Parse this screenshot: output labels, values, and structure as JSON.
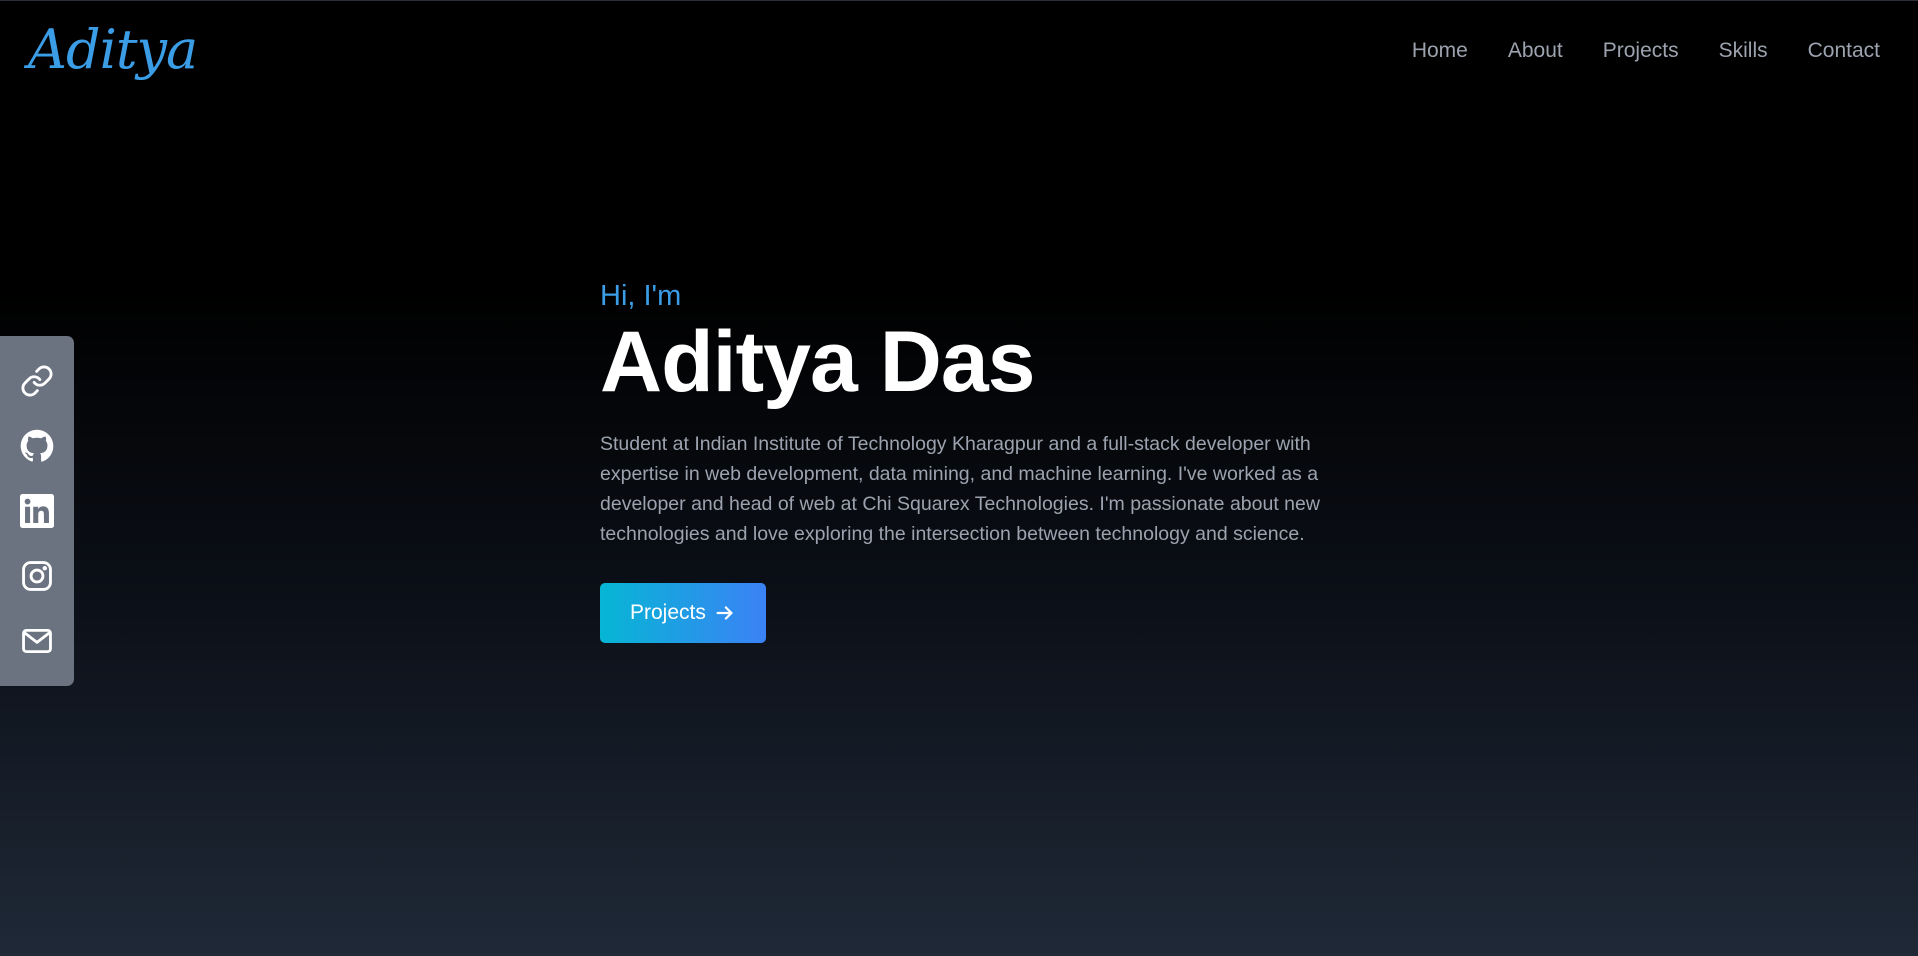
{
  "brand": {
    "logo_text": "Aditya",
    "accent_color": "#3b9de6"
  },
  "nav": {
    "items": [
      {
        "label": "Home"
      },
      {
        "label": "About"
      },
      {
        "label": "Projects"
      },
      {
        "label": "Skills"
      },
      {
        "label": "Contact"
      }
    ]
  },
  "social": {
    "background_color": "#6b7280",
    "icons": [
      "link-icon",
      "github-icon",
      "linkedin-icon",
      "instagram-icon",
      "mail-icon"
    ]
  },
  "hero": {
    "greeting": "Hi, I'm",
    "name": "Aditya Das",
    "description": "Student at Indian Institute of Technology Kharagpur and a full-stack developer with expertise in web development, data mining, and machine learning. I've worked as a developer and head of web at Chi Squarex Technologies. I'm passionate about new technologies and love exploring the intersection between technology and science.",
    "cta_label": "Projects",
    "cta_icon": "arrow-right-icon",
    "cta_gradient": [
      "#06b6d4",
      "#3b82f6"
    ]
  }
}
